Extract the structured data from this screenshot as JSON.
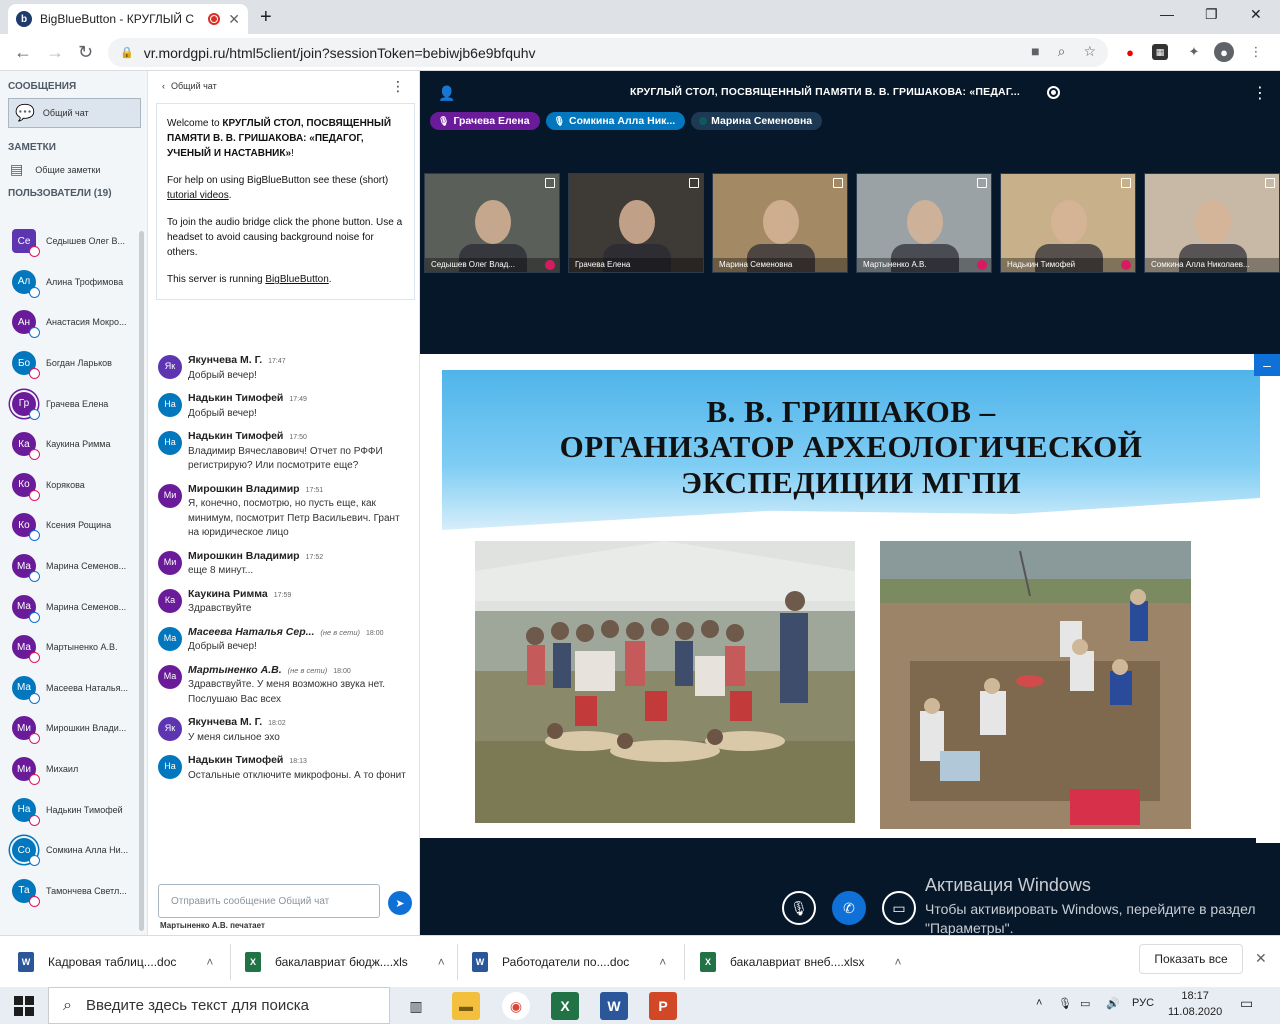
{
  "browser": {
    "tab_title": "BigBlueButton - КРУГЛЫЙ С",
    "tab_fav": "b",
    "url": "vr.mordgpi.ru/html5client/join?sessionToken=bebiwjb6e9bfquhv",
    "new_tab": "+",
    "win_min": "—",
    "win_max": "❐",
    "win_close": "✕"
  },
  "sidebar": {
    "messages_header": "СООБЩЕНИЯ",
    "public_chat": "Общий чат",
    "notes_header": "ЗАМЕТКИ",
    "shared_notes": "Общие заметки",
    "users_header": "ПОЛЬЗОВАТЕЛИ (19)",
    "users": [
      {
        "initials": "Се",
        "name": "Седышев Олег В...",
        "color": "#5e35b1",
        "mic": "muted",
        "square": true
      },
      {
        "initials": "Ал",
        "name": "Алина Трофимова",
        "color": "#0277bd",
        "mic": "on"
      },
      {
        "initials": "Ан",
        "name": "Анастасия Мокро...",
        "color": "#6a1b9a",
        "mic": "on"
      },
      {
        "initials": "Бо",
        "name": "Богдан Ларьков",
        "color": "#0277bd",
        "mic": "muted"
      },
      {
        "initials": "Гр",
        "name": "Грачева Елена",
        "color": "#6a1b9a",
        "mic": "on",
        "ring": true
      },
      {
        "initials": "Ка",
        "name": "Каукина Римма",
        "color": "#6a1b9a",
        "mic": "muted"
      },
      {
        "initials": "Ко",
        "name": "Корякова",
        "color": "#6a1b9a",
        "mic": "muted"
      },
      {
        "initials": "Ко",
        "name": "Ксения Рощина",
        "color": "#6a1b9a",
        "mic": "on"
      },
      {
        "initials": "Ма",
        "name": "Марина Семенов...",
        "color": "#6a1b9a",
        "mic": "on"
      },
      {
        "initials": "Ма",
        "name": "Марина Семенов...",
        "color": "#6a1b9a",
        "mic": "on"
      },
      {
        "initials": "Ма",
        "name": "Мартыненко А.В.",
        "color": "#6a1b9a",
        "mic": "muted"
      },
      {
        "initials": "Ма",
        "name": "Масеева Наталья...",
        "color": "#0277bd",
        "mic": "on"
      },
      {
        "initials": "Ми",
        "name": "Мирошкин Влади...",
        "color": "#6a1b9a",
        "mic": "muted"
      },
      {
        "initials": "Ми",
        "name": "Михаил",
        "color": "#6a1b9a",
        "mic": "muted"
      },
      {
        "initials": "На",
        "name": "Надькин Тимофей",
        "color": "#0277bd",
        "mic": "muted"
      },
      {
        "initials": "Со",
        "name": "Сомкина Алла Ни...",
        "color": "#0277bd",
        "mic": "on",
        "ring": true
      },
      {
        "initials": "Та",
        "name": "Тамончева Светл...",
        "color": "#0277bd",
        "mic": "muted"
      }
    ]
  },
  "chat": {
    "title": "Общий чат",
    "welcome_prefix": "Welcome to ",
    "welcome_name": "КРУГЛЫЙ СТОЛ, ПОСВЯЩЕННЫЙ ПАМЯТИ В. В. ГРИШАКОВА: «ПЕДАГОГ, УЧЕНЫЙ И НАСТАВНИК»",
    "welcome_suffix": "!",
    "help_prefix": "For help on using BigBlueButton see these (short) ",
    "help_link": "tutorial videos",
    "help_suffix": ".",
    "audio_help": "To join the audio bridge click the phone button. Use a headset to avoid causing background noise for others.",
    "server_prefix": "This server is running ",
    "server_link": "BigBlueButton",
    "server_suffix": ".",
    "messages": [
      {
        "initials": "Як",
        "color": "#5e35b1",
        "author": "Якунчева М. Г.",
        "time": "17:47",
        "text": "Добрый вечер!"
      },
      {
        "initials": "На",
        "color": "#0277bd",
        "author": "Надькин Тимофей",
        "time": "17:49",
        "text": "Добрый вечер!"
      },
      {
        "initials": "На",
        "color": "#0277bd",
        "author": "Надькин Тимофей",
        "time": "17:50",
        "text": "Владимир Вячеславович! Отчет по РФФИ регистрирую? Или посмотрите еще?"
      },
      {
        "initials": "Ми",
        "color": "#6a1b9a",
        "author": "Мирошкин Владимир",
        "time": "17:51",
        "text": "Я, конечно, посмотрю, но пусть еще, как минимум, посмотрит Петр Васильевич. Грант на юридическое лицо"
      },
      {
        "initials": "Ми",
        "color": "#6a1b9a",
        "author": "Мирошкин Владимир",
        "time": "17:52",
        "text": "еще 8 минут..."
      },
      {
        "initials": "Ка",
        "color": "#6a1b9a",
        "author": "Каукина Римма",
        "time": "17:59",
        "text": "Здравствуйте"
      },
      {
        "initials": "Ма",
        "color": "#0277bd",
        "author": "Масеева Наталья Сер...",
        "time": "18:00",
        "offline": "(не в сети)",
        "text": "Добрый вечер!"
      },
      {
        "initials": "Ма",
        "color": "#6a1b9a",
        "author": "Мартыненко А.В.",
        "time": "18:00",
        "offline": "(не в сети)",
        "text": "Здравствуйте. У меня возможно звука нет. Послушаю Вас всех"
      },
      {
        "initials": "Як",
        "color": "#5e35b1",
        "author": "Якунчева М. Г.",
        "time": "18:02",
        "text": "У меня сильное эхо"
      },
      {
        "initials": "На",
        "color": "#0277bd",
        "author": "Надькин Тимофей",
        "time": "18:13",
        "text": "Остальные отключите микрофоны. А то фонит"
      }
    ],
    "input_placeholder": "Отправить сообщение Общий чат",
    "typing": "Мартыненко А.В. печатает"
  },
  "meeting": {
    "title": "КРУГЛЫЙ СТОЛ, ПОСВЯЩЕННЫЙ ПАМЯТИ В. В. ГРИШАКОВА: «ПЕДАГ...",
    "talkers": [
      {
        "name": "Грачева Елена",
        "color": "#6a1b9a"
      },
      {
        "name": "Сомкина Алла Ник...",
        "color": "#0277bd"
      },
      {
        "name": "Марина Семеновна",
        "color": "#1d3954"
      }
    ],
    "videos": [
      {
        "name": "Седышев Олег Влад...",
        "bg": "#5b5f5a",
        "muted": true
      },
      {
        "name": "Грачева Елена",
        "bg": "#3e3a36",
        "muted": false
      },
      {
        "name": "Марина Семеновна",
        "bg": "#a38a64",
        "muted": false
      },
      {
        "name": "Мартыненко А.В.",
        "bg": "#9aa2a6",
        "muted": true
      },
      {
        "name": "Надькин Тимофей",
        "bg": "#c7b08a",
        "muted": true
      },
      {
        "name": "Сомкина Алла Николаев...",
        "bg": "#c8b9a6",
        "muted": false
      }
    ],
    "slide_title_1": "В. В. ГРИШАКОВ –",
    "slide_title_2": "ОРГАНИЗАТОР АРХЕОЛОГИЧЕСКОЙ",
    "slide_title_3": "ЭКСПЕДИЦИИ МГПИ",
    "minimize": "–",
    "activation_title": "Активация Windows",
    "activation_text": "Чтобы активировать Windows, перейдите в раздел \"Параметры\"."
  },
  "downloads": [
    {
      "name": "Кадровая таблиц....doc",
      "type": "W",
      "color": "#2b579a"
    },
    {
      "name": "бакалавриат бюдж....xls",
      "type": "X",
      "color": "#217346"
    },
    {
      "name": "Работодатели по....doc",
      "type": "W",
      "color": "#2b579a"
    },
    {
      "name": "бакалавриат внеб....xlsx",
      "type": "X",
      "color": "#217346"
    }
  ],
  "downloads_show_all": "Показать все",
  "taskbar": {
    "search_placeholder": "Введите здесь текст для поиска",
    "lang": "РУС",
    "time": "18:17",
    "date": "11.08.2020"
  }
}
